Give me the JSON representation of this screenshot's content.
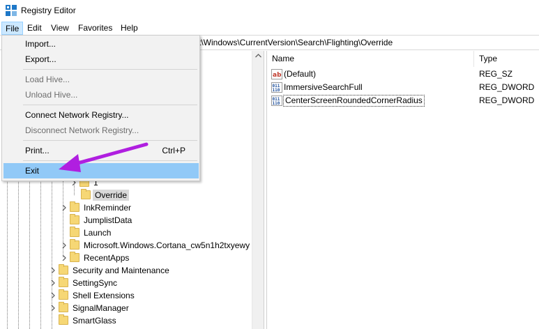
{
  "window": {
    "title": "Registry Editor",
    "icon": "registry-icon"
  },
  "menubar": {
    "items": [
      "File",
      "Edit",
      "View",
      "Favorites",
      "Help"
    ],
    "active": "File"
  },
  "address": {
    "value": "t\\Windows\\CurrentVersion\\Search\\Flighting\\Override"
  },
  "file_menu": {
    "items": [
      {
        "label": "Import...",
        "enabled": true
      },
      {
        "label": "Export...",
        "enabled": true
      },
      {
        "label": "Load Hive...",
        "enabled": false
      },
      {
        "label": "Unload Hive...",
        "enabled": false
      },
      {
        "label": "Connect Network Registry...",
        "enabled": true
      },
      {
        "label": "Disconnect Network Registry...",
        "enabled": false
      },
      {
        "label": "Print...",
        "enabled": true,
        "shortcut": "Ctrl+P"
      },
      {
        "label": "Exit",
        "enabled": true,
        "highlighted": true
      }
    ]
  },
  "tree": {
    "partial_label": "1",
    "items": [
      {
        "label": "Override",
        "selected": true
      },
      {
        "label": "InkReminder"
      },
      {
        "label": "JumplistData"
      },
      {
        "label": "Launch"
      },
      {
        "label": "Microsoft.Windows.Cortana_cw5n1h2txyewy"
      },
      {
        "label": "RecentApps"
      },
      {
        "label": "Security and Maintenance"
      },
      {
        "label": "SettingSync"
      },
      {
        "label": "Shell Extensions"
      },
      {
        "label": "SignalManager"
      },
      {
        "label": "SmartGlass"
      }
    ]
  },
  "values_list": {
    "headers": {
      "name": "Name",
      "type": "Type"
    },
    "rows": [
      {
        "name": "(Default)",
        "type": "REG_SZ",
        "icon": "string-value-icon"
      },
      {
        "name": "ImmersiveSearchFull",
        "type": "REG_DWORD",
        "icon": "binary-value-icon"
      },
      {
        "name": "CenterScreenRoundedCornerRadius",
        "type": "REG_DWORD",
        "icon": "binary-value-icon",
        "focused": true
      }
    ]
  },
  "colors": {
    "menu_highlight": "#91c9f7",
    "annotation_arrow": "#b01fe0",
    "active_menu": "#cce8ff"
  }
}
